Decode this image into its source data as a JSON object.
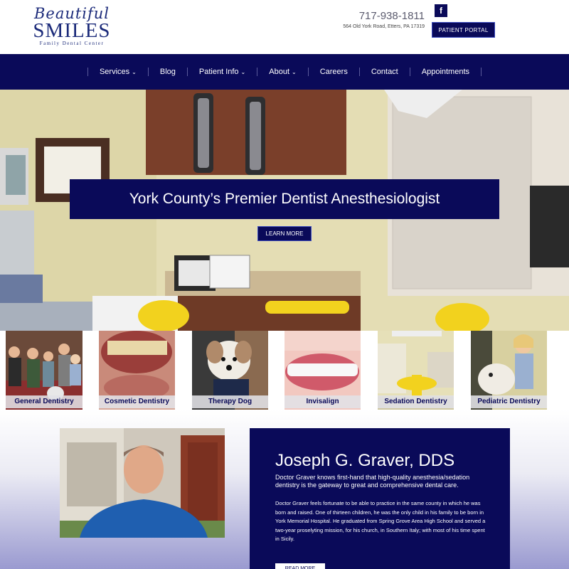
{
  "brand": {
    "logo_script": "Beautiful",
    "logo_main": "SMILES",
    "logo_tagline": "Family Dental Center"
  },
  "header": {
    "phone": "717-938-1811",
    "address": "564 Old York Road, Etters, PA 17319",
    "facebook_glyph": "f",
    "portal_label": "PATIENT PORTAL"
  },
  "nav": {
    "items": [
      {
        "label": "Services",
        "has_dropdown": true
      },
      {
        "label": "Blog",
        "has_dropdown": false
      },
      {
        "label": "Patient Info",
        "has_dropdown": true
      },
      {
        "label": "About",
        "has_dropdown": true
      },
      {
        "label": "Careers",
        "has_dropdown": false
      },
      {
        "label": "Contact",
        "has_dropdown": false
      },
      {
        "label": "Appointments",
        "has_dropdown": false
      }
    ],
    "caret_glyph": "⌄"
  },
  "hero": {
    "title": "York County’s Premier Dentist Anesthesiologist",
    "button_label": "LEARN MORE"
  },
  "services": {
    "tiles": [
      {
        "label": "General Dentistry",
        "icon": "family-photo"
      },
      {
        "label": "Cosmetic Dentistry",
        "icon": "teeth-photo"
      },
      {
        "label": "Therapy Dog",
        "icon": "dog-photo"
      },
      {
        "label": "Invisalign",
        "icon": "smile-photo"
      },
      {
        "label": "Sedation Dentistry",
        "icon": "dental-chair-photo"
      },
      {
        "label": "Pediatric Dentistry",
        "icon": "child-dog-photo"
      }
    ]
  },
  "doctor": {
    "name": "Joseph G. Graver, DDS",
    "lead": "Doctor Graver knows first-hand that high-quality anesthesia/sedation dentistry is the gateway to great and comprehensive dental care.",
    "body": "Doctor Graver feels fortunate to be able to practice in the same county in which he was born and raised. One of thirteen children, he was the only child in his family to be born in York Memorial Hospital. He graduated from Spring Grove Area High School and served a two-year proselyting mission, for his church, in Southern Italy; with most of his time spent in Sicily.",
    "button_label": "READ MORE"
  },
  "colors": {
    "navy": "#0a0a59",
    "accent_border": "#3b4bbf",
    "logo_blue": "#1c2b7a"
  }
}
